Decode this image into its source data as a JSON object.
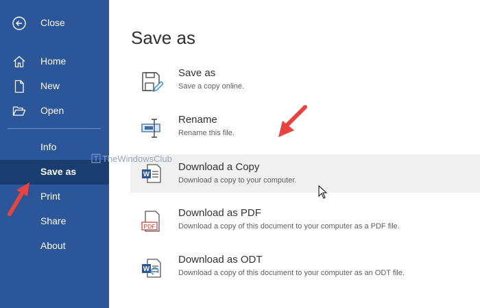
{
  "sidebar": {
    "close": {
      "label": "Close",
      "icon": "back-arrow-circle-icon"
    },
    "items": [
      {
        "label": "Home",
        "icon": "home-icon"
      },
      {
        "label": "New",
        "icon": "new-document-icon"
      },
      {
        "label": "Open",
        "icon": "folder-open-icon"
      },
      {
        "label": "Info"
      },
      {
        "label": "Save as",
        "active": true
      },
      {
        "label": "Print"
      },
      {
        "label": "Share"
      },
      {
        "label": "About"
      }
    ]
  },
  "main": {
    "title": "Save as",
    "options": [
      {
        "title": "Save as",
        "description": "Save a copy online.",
        "icon": "save-as-icon"
      },
      {
        "title": "Rename",
        "description": "Rename this file.",
        "icon": "rename-icon"
      },
      {
        "title": "Download a Copy",
        "description": "Download a copy to your computer.",
        "icon": "word-document-icon",
        "hovered": true
      },
      {
        "title": "Download as PDF",
        "description": "Download a copy of this document to your computer as a PDF file.",
        "icon": "pdf-document-icon",
        "icon_text": "PDF"
      },
      {
        "title": "Download as ODT",
        "description": "Download a copy of this document to your computer as an ODT file.",
        "icon": "odt-document-icon"
      }
    ]
  },
  "watermark": {
    "text": "TheWindowsClub"
  },
  "colors": {
    "sidebar": "#2b579a",
    "sidebar_active": "#1a3d70",
    "annotation_arrow": "#e8433f",
    "word_blue": "#2b579a"
  }
}
